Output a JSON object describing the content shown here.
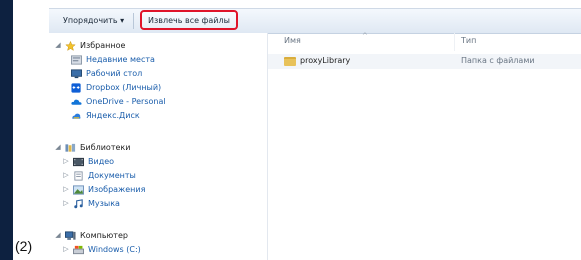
{
  "step_label": "(2)",
  "toolbar": {
    "organize_label": "Упорядочить ▾",
    "extract_label": "Извлечь все файлы"
  },
  "nav": {
    "favorites": {
      "label": "Избранное",
      "items": [
        {
          "label": "Недавние места",
          "icon": "recent-places-icon"
        },
        {
          "label": "Рабочий стол",
          "icon": "desktop-icon"
        },
        {
          "label": "Dropbox (Личный)",
          "icon": "dropbox-icon"
        },
        {
          "label": "OneDrive - Personal",
          "icon": "onedrive-icon"
        },
        {
          "label": "Яндекс.Диск",
          "icon": "yandex-disk-icon"
        }
      ]
    },
    "libraries": {
      "label": "Библиотеки",
      "items": [
        {
          "label": "Видео",
          "icon": "video-library-icon"
        },
        {
          "label": "Документы",
          "icon": "documents-library-icon"
        },
        {
          "label": "Изображения",
          "icon": "images-library-icon"
        },
        {
          "label": "Музыка",
          "icon": "music-library-icon"
        }
      ]
    },
    "computer": {
      "label": "Компьютер",
      "items": [
        {
          "label": "Windows (C:)",
          "icon": "drive-icon"
        }
      ]
    }
  },
  "columns": {
    "name": "Имя",
    "type": "Тип"
  },
  "files": [
    {
      "name": "proxyLibrary",
      "type": "Папка с файлами",
      "icon": "folder-icon"
    }
  ],
  "colors": {
    "highlight_border": "#e0142a",
    "link": "#1a5dab"
  }
}
